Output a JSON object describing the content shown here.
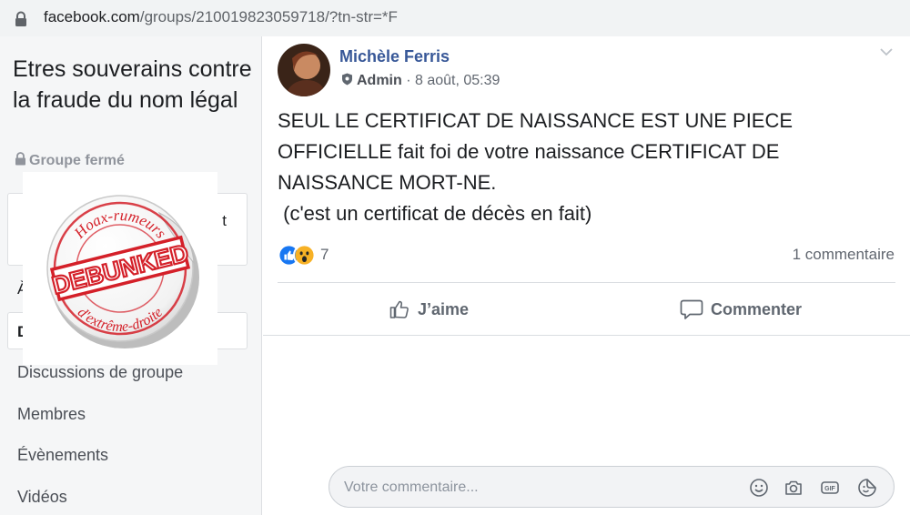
{
  "browser": {
    "url_host": "facebook.com",
    "url_path": "/groups/210019823059718/?tn-str=*F"
  },
  "sidebar": {
    "group_name": "Etres souverains contre la fraude du nom légal",
    "group_status": "Groupe fermé",
    "card_partial_text": "t",
    "partial_item_1": "À",
    "partial_item_2": "D",
    "nav_items": [
      "Discussions de groupe",
      "Membres",
      "Évènements",
      "Vidéos"
    ]
  },
  "stamp": {
    "top_text": "Hoax-rumeurs",
    "main_text": "DEBUNKED",
    "bottom_text": "d'extrême-droite",
    "color": "#d42029"
  },
  "post": {
    "author": "Michèle Ferris",
    "role": "Admin",
    "timestamp": "8 août, 05:39",
    "text_lines": [
      "SEUL LE CERTIFICAT DE NAISSANCE EST UNE PIECE",
      "OFFICIELLE fait foi de votre naissance CERTIFICAT DE",
      "NAISSANCE MORT-NE.",
      " (c'est un certificat de décès en fait)"
    ],
    "reactions": [
      "like-icon",
      "wow-icon"
    ],
    "reaction_count": "7",
    "comment_count": "1 commentaire",
    "like_label": "J’aime",
    "comment_label": "Commenter",
    "comment_placeholder": "Votre commentaire..."
  },
  "colors": {
    "link": "#385898",
    "like_blue": "#1877f2",
    "wow_yellow": "#f7b125",
    "sidebar_bg": "#f5f6f7"
  }
}
